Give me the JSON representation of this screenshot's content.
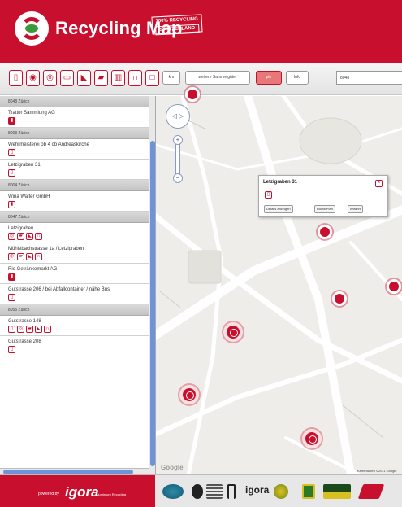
{
  "header": {
    "title": "Recycling Map",
    "badge_line1": "100% RECYCLING",
    "badge_line2": "SWITZERLAND",
    "brand_color": "#c8102e"
  },
  "toolbar": {
    "filter_icons": [
      "doc-icon",
      "battery-icon",
      "bottle-icon",
      "monitor-icon",
      "shoe-icon",
      "car-icon",
      "bin-icon",
      "magnet-icon",
      "light-icon"
    ],
    "btn_km": "km",
    "btn_area": "weitere Sammelgüter",
    "btn_active": "pin",
    "btn_info": "Info",
    "search_value": "8048"
  },
  "sidebar": {
    "groups": [
      {
        "label": "8048 Zürich",
        "items": [
          {
            "name": "Trattor Sammlung AG",
            "icons": [
              "filled"
            ]
          }
        ]
      },
      {
        "label": "8003 Zürich",
        "items": [
          {
            "name": "Wehrmeisterei ob 4 ob Andreaskirche",
            "icons": [
              "doc"
            ]
          },
          {
            "name": "Letzigraben 31",
            "icons": [
              "doc"
            ]
          }
        ]
      },
      {
        "label": "8004 Zürich",
        "items": [
          {
            "name": "Wina Walter GmbH",
            "icons": [
              "battery"
            ]
          }
        ]
      },
      {
        "label": "8047 Zürich",
        "items": [
          {
            "name": "Letzigraben",
            "icons": [
              "bottle",
              "can",
              "bottle",
              "magnet"
            ]
          },
          {
            "name": "Mühlebachstrasse 1a / Letzigraben",
            "icons": [
              "bottle",
              "can",
              "bottle",
              "magnet"
            ]
          },
          {
            "name": "Rio Getränkemarkt AG",
            "icons": [
              "filled"
            ]
          },
          {
            "name": "Gutstrasse 206 / bei Abfallcontainer / nähe Bus",
            "icons": [
              "doc"
            ]
          }
        ]
      },
      {
        "label": "8055 Zürich",
        "items": [
          {
            "name": "Gutstrasse 148",
            "icons": [
              "doc",
              "bottle",
              "can",
              "bottle",
              "magnet"
            ]
          },
          {
            "name": "Gutstrasse 208",
            "icons": [
              "doc"
            ]
          }
        ]
      }
    ]
  },
  "map": {
    "popup_title": "Letzigraben 31",
    "popup_btn1": "Details anzeigen",
    "popup_btn2": "Route/Plan",
    "popup_btn3": "Anfahrt",
    "google_label": "Google",
    "attribution": "Kartendaten ©2011 Google"
  },
  "footer": {
    "powered_label": "powered by",
    "logo_text": "igora",
    "logo_sub": "Aluminium Recycling",
    "sponsor_igora": "igora"
  }
}
